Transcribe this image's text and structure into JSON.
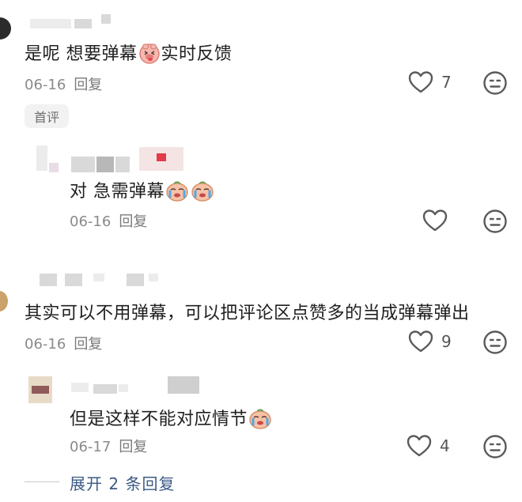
{
  "comments": [
    {
      "text_before": "是呢 想要弹幕",
      "text_after": "实时反馈",
      "date": "06-16",
      "reply_label": "回复",
      "likes": "7",
      "badge": "首评"
    },
    {
      "text_before": "对  急需弹幕",
      "text_after": "",
      "date": "06-16",
      "reply_label": "回复"
    },
    {
      "text_before": "其实可以不用弹幕，可以把评论区点赞多的当成弹幕弹出",
      "text_after": "",
      "date": "06-16",
      "reply_label": "回复",
      "likes": "9"
    },
    {
      "text_before": "但是这样不能对应情节",
      "text_after": "",
      "date": "06-17",
      "reply_label": "回复",
      "likes": "4"
    }
  ],
  "expand_replies": "展开 2 条回复",
  "icons": {
    "like": "heart-icon",
    "dislike": "neutral-face-icon",
    "emoji_pig": "pig-tongue-emoji",
    "emoji_cry": "crying-emoji"
  },
  "colors": {
    "text": "#1f1f1f",
    "meta": "#8a8a8a",
    "link": "#3b5a86",
    "icon": "#5a5a5a"
  }
}
